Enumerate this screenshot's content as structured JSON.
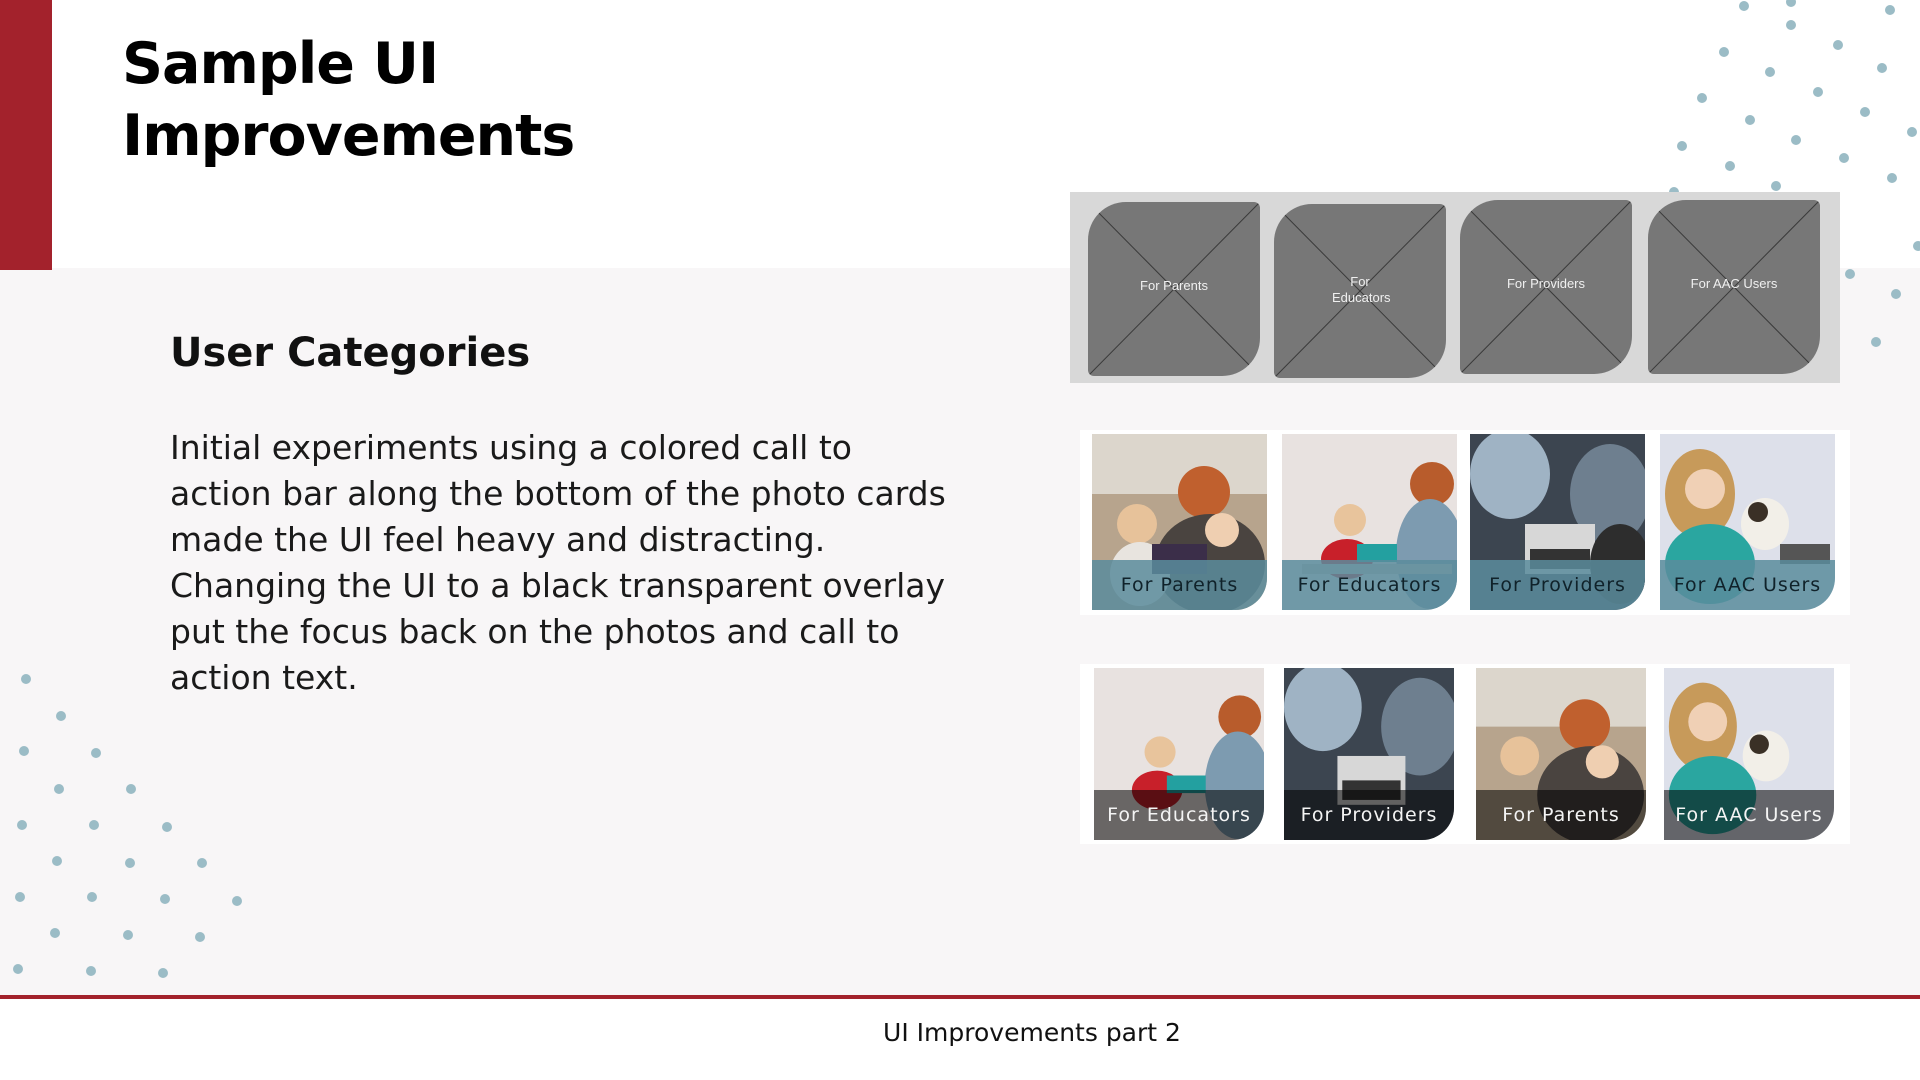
{
  "slide": {
    "title_line1": "Sample UI",
    "title_line2": "Improvements",
    "section_heading": "User Categories",
    "body": "Initial experiments using a colored call to action bar along the bottom of the photo cards made the UI feel heavy and distracting. Changing the UI to a black transparent overlay put the focus back on the photos and call to action text.",
    "footer": "UI Improvements part 2"
  },
  "wireframe_cards": [
    {
      "label": "For Parents"
    },
    {
      "label": "For Educators"
    },
    {
      "label": "For Providers"
    },
    {
      "label": "For AAC Users"
    }
  ],
  "colored_bar_cards": [
    {
      "label": "For Parents"
    },
    {
      "label": "For Educators"
    },
    {
      "label": "For Providers"
    },
    {
      "label": "For AAC Users"
    }
  ],
  "overlay_cards": [
    {
      "label": "For Educators"
    },
    {
      "label": "For Providers"
    },
    {
      "label": "For Parents"
    },
    {
      "label": "For AAC Users"
    }
  ],
  "colors": {
    "accent": "#a3222c",
    "dots": "#9bbcc6",
    "cta_teal": "#5a8c9c",
    "overlay": "#000000"
  }
}
